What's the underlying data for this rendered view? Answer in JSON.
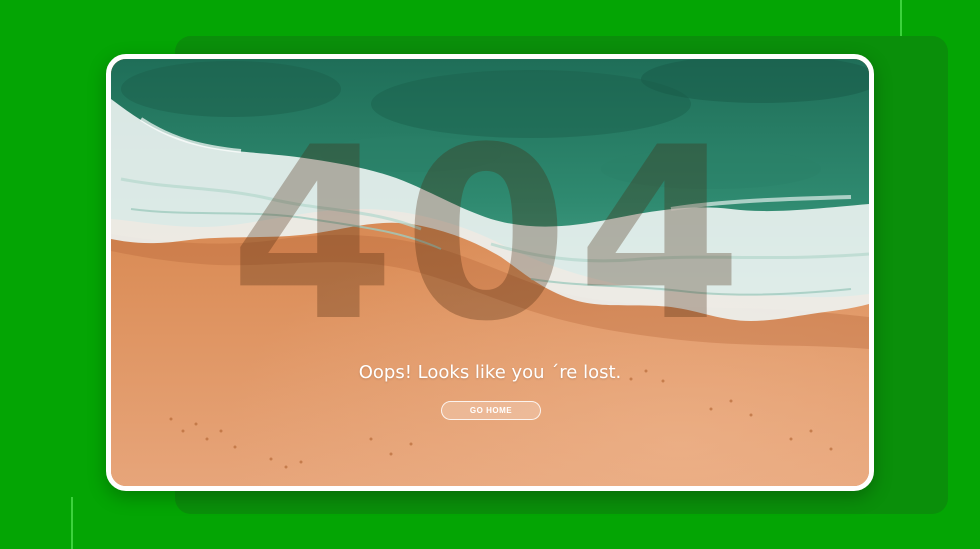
{
  "error": {
    "code": "404",
    "message": "Oops! Looks like you ´re lost.",
    "home_button_label": "GO HOME"
  },
  "colors": {
    "background": "#04a504",
    "back_panel": "#0a8f0a",
    "card_border": "#ffffff",
    "sea_deep": "#2b7a62",
    "sea_light": "#3f9a80",
    "foam": "#f2f6f5",
    "sand": "#d98a55",
    "sand_dark": "#c97540"
  },
  "icons": {
    "scene": "beach-aerial-illustration"
  }
}
